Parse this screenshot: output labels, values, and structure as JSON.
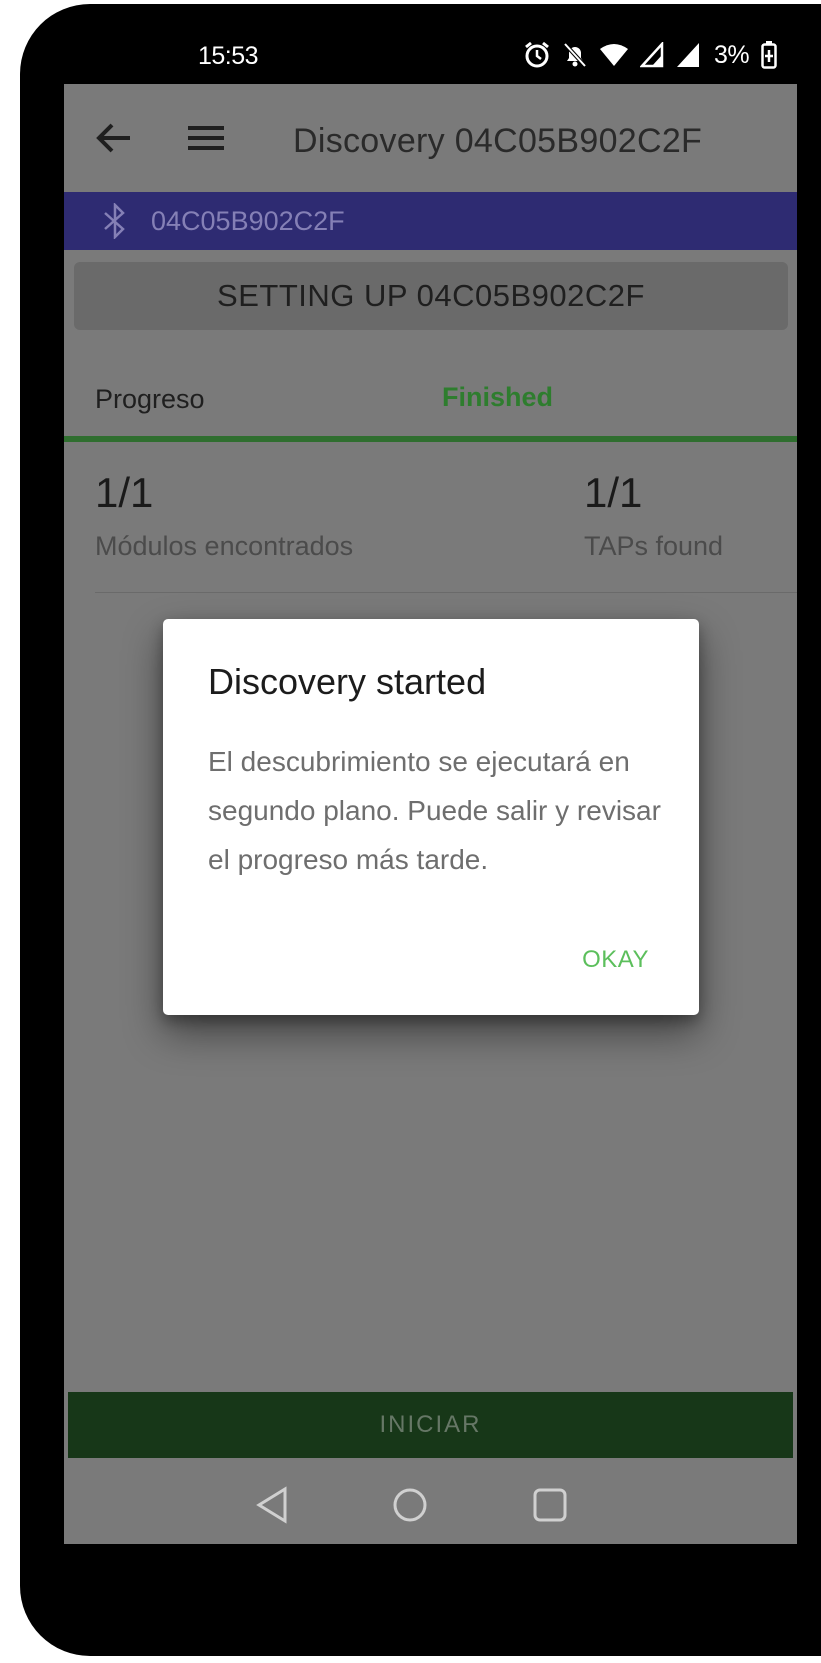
{
  "status_bar": {
    "time": "15:53",
    "battery": "3%",
    "icons": [
      "alarm-icon",
      "notifications-off-icon",
      "wifi-icon",
      "signal-icon",
      "signal-icon",
      "battery-charging-icon"
    ]
  },
  "app_bar": {
    "title": "Discovery 04C05B902C2F",
    "back_icon": "arrow-back-icon",
    "menu_icon": "hamburger-menu-icon"
  },
  "bluetooth_bar": {
    "icon": "bluetooth-icon",
    "device_id": "04C05B902C2F"
  },
  "setup_button": {
    "label": "SETTING UP 04C05B902C2F"
  },
  "progress": {
    "label": "Progreso",
    "status": "Finished",
    "fraction": 1.0
  },
  "stats": {
    "modules": {
      "value": "1/1",
      "label": "Módulos encontrados"
    },
    "taps": {
      "value": "1/1",
      "label": "TAPs found"
    }
  },
  "start_button": {
    "label": "INICIAR"
  },
  "dialog": {
    "title": "Discovery started",
    "body": "El descubrimiento se ejecutará en segundo plano. Puede salir y revisar el progreso más tarde.",
    "ok_label": "OKAY"
  },
  "nav_bar": {
    "icons": [
      "nav-back-icon",
      "nav-home-icon",
      "nav-recent-icon"
    ]
  },
  "colors": {
    "bluetooth_bar": "#2e2b72",
    "finished": "#2e7d2e",
    "ok_button": "#5cbf5c",
    "start_button": "#173718"
  }
}
